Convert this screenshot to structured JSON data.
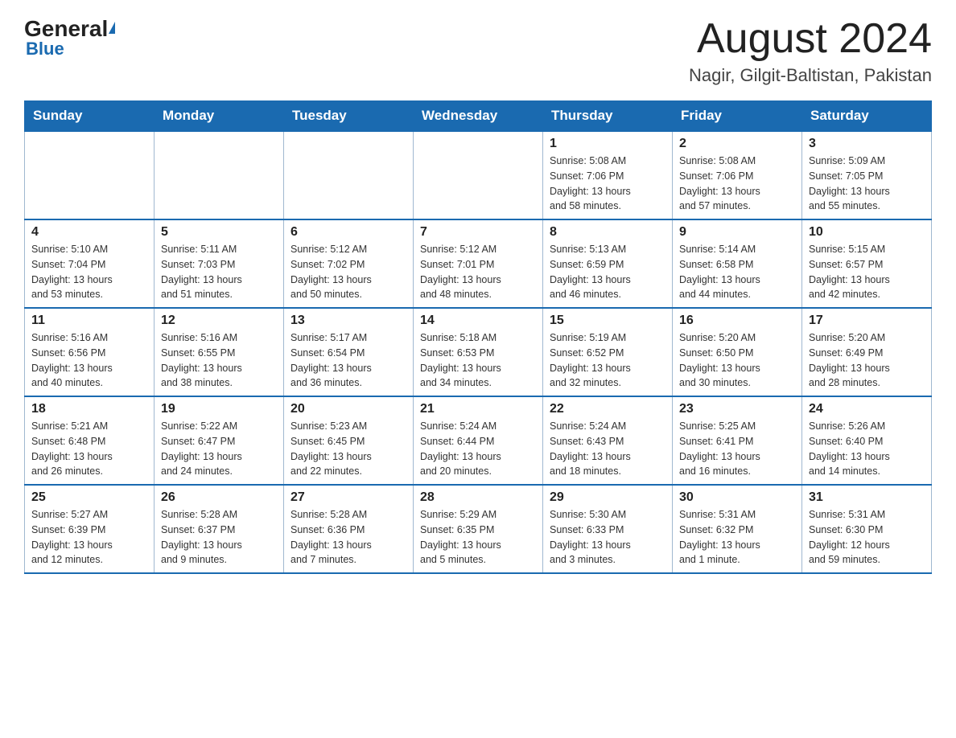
{
  "header": {
    "logo_general": "General",
    "logo_blue": "Blue",
    "title": "August 2024",
    "location": "Nagir, Gilgit-Baltistan, Pakistan"
  },
  "days_of_week": [
    "Sunday",
    "Monday",
    "Tuesday",
    "Wednesday",
    "Thursday",
    "Friday",
    "Saturday"
  ],
  "weeks": [
    [
      {
        "day": "",
        "info": ""
      },
      {
        "day": "",
        "info": ""
      },
      {
        "day": "",
        "info": ""
      },
      {
        "day": "",
        "info": ""
      },
      {
        "day": "1",
        "info": "Sunrise: 5:08 AM\nSunset: 7:06 PM\nDaylight: 13 hours\nand 58 minutes."
      },
      {
        "day": "2",
        "info": "Sunrise: 5:08 AM\nSunset: 7:06 PM\nDaylight: 13 hours\nand 57 minutes."
      },
      {
        "day": "3",
        "info": "Sunrise: 5:09 AM\nSunset: 7:05 PM\nDaylight: 13 hours\nand 55 minutes."
      }
    ],
    [
      {
        "day": "4",
        "info": "Sunrise: 5:10 AM\nSunset: 7:04 PM\nDaylight: 13 hours\nand 53 minutes."
      },
      {
        "day": "5",
        "info": "Sunrise: 5:11 AM\nSunset: 7:03 PM\nDaylight: 13 hours\nand 51 minutes."
      },
      {
        "day": "6",
        "info": "Sunrise: 5:12 AM\nSunset: 7:02 PM\nDaylight: 13 hours\nand 50 minutes."
      },
      {
        "day": "7",
        "info": "Sunrise: 5:12 AM\nSunset: 7:01 PM\nDaylight: 13 hours\nand 48 minutes."
      },
      {
        "day": "8",
        "info": "Sunrise: 5:13 AM\nSunset: 6:59 PM\nDaylight: 13 hours\nand 46 minutes."
      },
      {
        "day": "9",
        "info": "Sunrise: 5:14 AM\nSunset: 6:58 PM\nDaylight: 13 hours\nand 44 minutes."
      },
      {
        "day": "10",
        "info": "Sunrise: 5:15 AM\nSunset: 6:57 PM\nDaylight: 13 hours\nand 42 minutes."
      }
    ],
    [
      {
        "day": "11",
        "info": "Sunrise: 5:16 AM\nSunset: 6:56 PM\nDaylight: 13 hours\nand 40 minutes."
      },
      {
        "day": "12",
        "info": "Sunrise: 5:16 AM\nSunset: 6:55 PM\nDaylight: 13 hours\nand 38 minutes."
      },
      {
        "day": "13",
        "info": "Sunrise: 5:17 AM\nSunset: 6:54 PM\nDaylight: 13 hours\nand 36 minutes."
      },
      {
        "day": "14",
        "info": "Sunrise: 5:18 AM\nSunset: 6:53 PM\nDaylight: 13 hours\nand 34 minutes."
      },
      {
        "day": "15",
        "info": "Sunrise: 5:19 AM\nSunset: 6:52 PM\nDaylight: 13 hours\nand 32 minutes."
      },
      {
        "day": "16",
        "info": "Sunrise: 5:20 AM\nSunset: 6:50 PM\nDaylight: 13 hours\nand 30 minutes."
      },
      {
        "day": "17",
        "info": "Sunrise: 5:20 AM\nSunset: 6:49 PM\nDaylight: 13 hours\nand 28 minutes."
      }
    ],
    [
      {
        "day": "18",
        "info": "Sunrise: 5:21 AM\nSunset: 6:48 PM\nDaylight: 13 hours\nand 26 minutes."
      },
      {
        "day": "19",
        "info": "Sunrise: 5:22 AM\nSunset: 6:47 PM\nDaylight: 13 hours\nand 24 minutes."
      },
      {
        "day": "20",
        "info": "Sunrise: 5:23 AM\nSunset: 6:45 PM\nDaylight: 13 hours\nand 22 minutes."
      },
      {
        "day": "21",
        "info": "Sunrise: 5:24 AM\nSunset: 6:44 PM\nDaylight: 13 hours\nand 20 minutes."
      },
      {
        "day": "22",
        "info": "Sunrise: 5:24 AM\nSunset: 6:43 PM\nDaylight: 13 hours\nand 18 minutes."
      },
      {
        "day": "23",
        "info": "Sunrise: 5:25 AM\nSunset: 6:41 PM\nDaylight: 13 hours\nand 16 minutes."
      },
      {
        "day": "24",
        "info": "Sunrise: 5:26 AM\nSunset: 6:40 PM\nDaylight: 13 hours\nand 14 minutes."
      }
    ],
    [
      {
        "day": "25",
        "info": "Sunrise: 5:27 AM\nSunset: 6:39 PM\nDaylight: 13 hours\nand 12 minutes."
      },
      {
        "day": "26",
        "info": "Sunrise: 5:28 AM\nSunset: 6:37 PM\nDaylight: 13 hours\nand 9 minutes."
      },
      {
        "day": "27",
        "info": "Sunrise: 5:28 AM\nSunset: 6:36 PM\nDaylight: 13 hours\nand 7 minutes."
      },
      {
        "day": "28",
        "info": "Sunrise: 5:29 AM\nSunset: 6:35 PM\nDaylight: 13 hours\nand 5 minutes."
      },
      {
        "day": "29",
        "info": "Sunrise: 5:30 AM\nSunset: 6:33 PM\nDaylight: 13 hours\nand 3 minutes."
      },
      {
        "day": "30",
        "info": "Sunrise: 5:31 AM\nSunset: 6:32 PM\nDaylight: 13 hours\nand 1 minute."
      },
      {
        "day": "31",
        "info": "Sunrise: 5:31 AM\nSunset: 6:30 PM\nDaylight: 12 hours\nand 59 minutes."
      }
    ]
  ]
}
